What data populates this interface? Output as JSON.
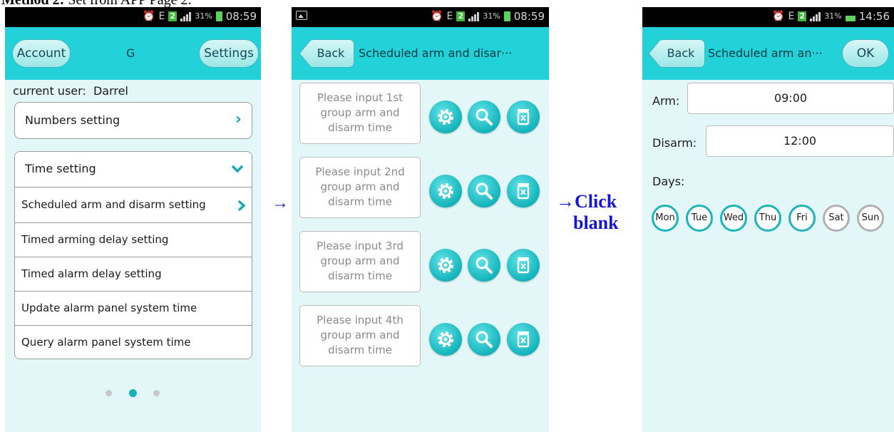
{
  "heading": {
    "prefix": "Method 2:",
    "rest": "Set from APP Page 2:"
  },
  "arrows": {
    "first": "→",
    "second_line1": "→Click",
    "second_line2": "blank"
  },
  "status": {
    "screen1_time": "08:59",
    "screen2_time": "08:59",
    "screen3_time": "14:56",
    "battery_12": "31%",
    "battery_3": "31%",
    "sim": "2",
    "net": "E"
  },
  "screen1": {
    "account_label": "Account",
    "center_label": "G",
    "settings_label": "Settings",
    "current_user": "current user:  Darrel",
    "numbers_setting": "Numbers setting",
    "time_setting": "Time setting",
    "items": [
      "Scheduled arm and disarm setting",
      "Timed arming delay setting",
      "Timed alarm delay setting",
      "Update alarm panel system time",
      "Query alarm panel system time"
    ],
    "page_count": 3,
    "active_page": 2
  },
  "screen2": {
    "back_label": "Back",
    "title": "Scheduled arm and disar···",
    "groups": [
      [
        "Please input 1st",
        "group arm and",
        "disarm time"
      ],
      [
        "Please input 2nd",
        "group arm and",
        "disarm time"
      ],
      [
        "Please input 3rd",
        "group arm and",
        "disarm time"
      ],
      [
        "Please input 4th",
        "group arm and",
        "disarm time"
      ]
    ]
  },
  "screen3": {
    "back_label": "Back",
    "title": "Scheduled arm an···",
    "ok_label": "OK",
    "arm_label": "Arm:",
    "arm_value": "09:00",
    "disarm_label": "Disarm:",
    "disarm_value": "12:00",
    "days_label": "Days:",
    "days": [
      {
        "label": "Mon",
        "selected": true
      },
      {
        "label": "Tue",
        "selected": true
      },
      {
        "label": "Wed",
        "selected": true
      },
      {
        "label": "Thu",
        "selected": true
      },
      {
        "label": "Fri",
        "selected": true
      },
      {
        "label": "Sat",
        "selected": false
      },
      {
        "label": "Sun",
        "selected": false
      }
    ]
  },
  "colors": {
    "title_bar": "#22d2d8",
    "background": "#e4f7f8",
    "accent": "#1aa9b3"
  }
}
